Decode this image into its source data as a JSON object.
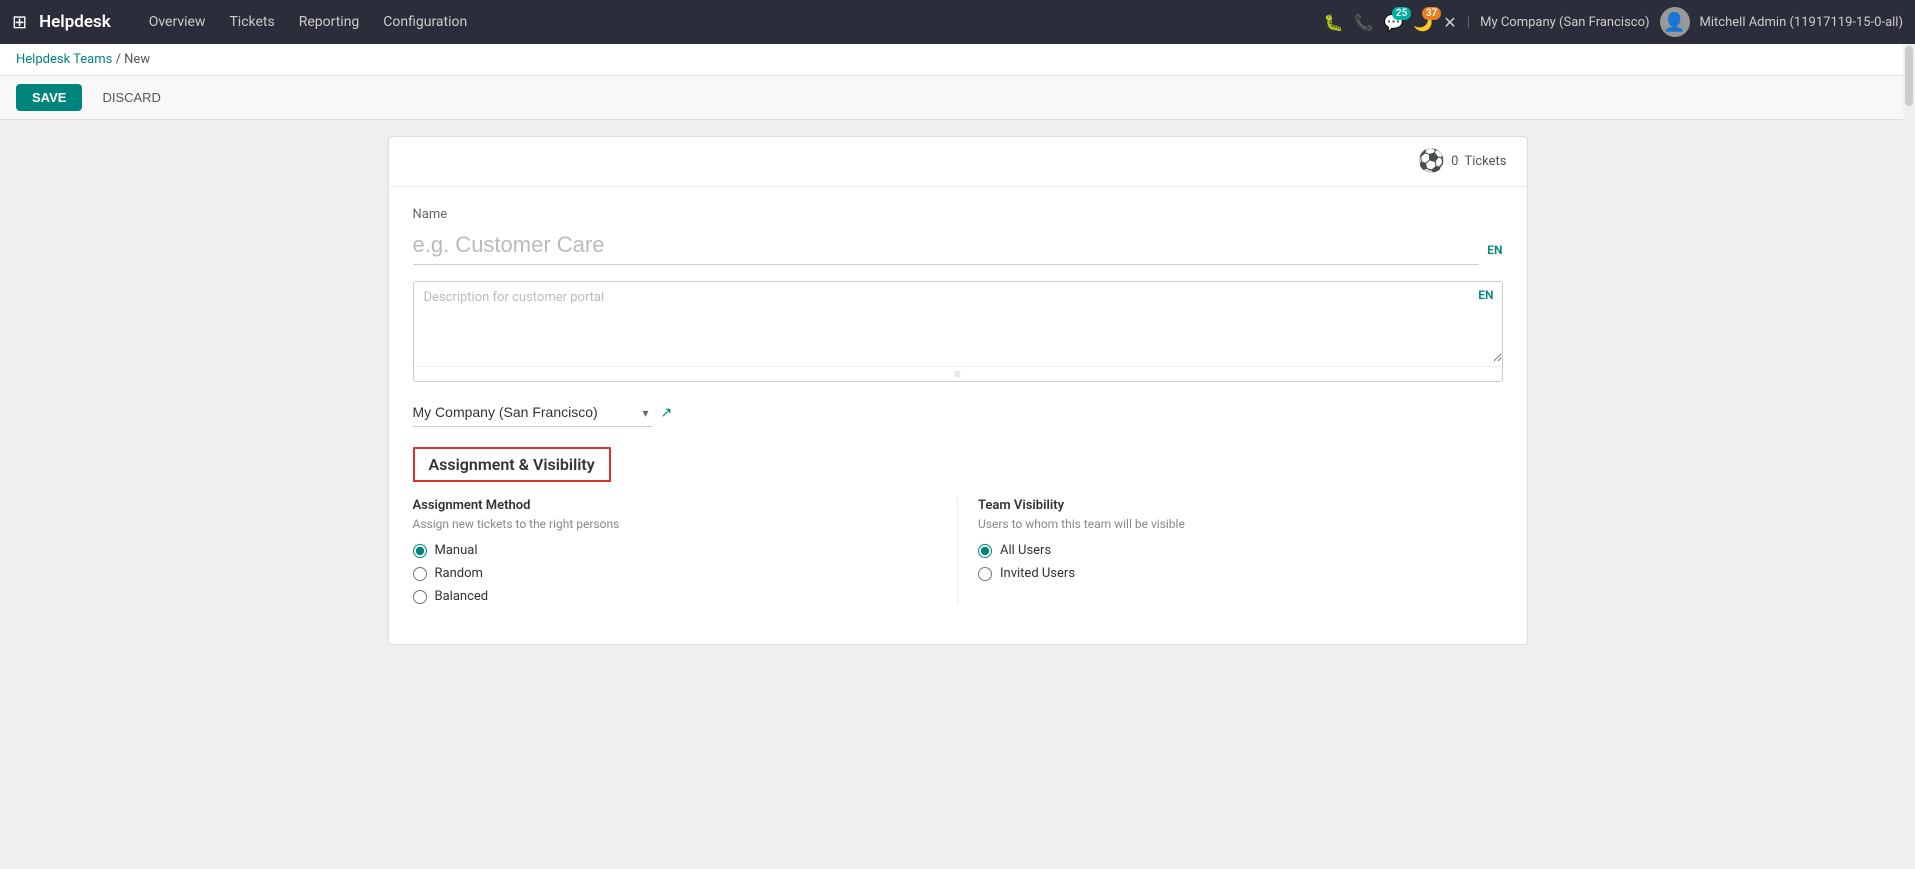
{
  "topnav": {
    "apps_icon": "⊞",
    "brand": "Helpdesk",
    "menu_items": [
      {
        "label": "Overview",
        "active": false
      },
      {
        "label": "Tickets",
        "active": false
      },
      {
        "label": "Reporting",
        "active": false
      },
      {
        "label": "Configuration",
        "active": false
      }
    ],
    "icons": {
      "bug": "🐛",
      "phone": "📞",
      "chat": "💬",
      "chat_badge": "25",
      "moon": "🌙",
      "moon_badge": "37",
      "close": "✕"
    },
    "company": "My Company (San Francisco)",
    "username": "Mitchell Admin (11917119-15-0-all)"
  },
  "breadcrumb": {
    "parent": "Helpdesk Teams",
    "current": "New"
  },
  "actions": {
    "save_label": "SAVE",
    "discard_label": "DISCARD"
  },
  "form": {
    "stat_icon": "⚽",
    "stat_count": "0",
    "stat_label": "Tickets",
    "name_label": "Name",
    "name_placeholder": "e.g. Customer Care",
    "lang_badge": "EN",
    "desc_placeholder": "Description for customer portal",
    "desc_lang_badge": "EN",
    "company_value": "My Company (San Francisco)",
    "section_title": "Assignment & Visibility",
    "assignment_method_label": "Assignment Method",
    "assignment_method_desc": "Assign new tickets to the right persons",
    "assignment_options": [
      {
        "value": "manual",
        "label": "Manual",
        "checked": true
      },
      {
        "value": "random",
        "label": "Random",
        "checked": false
      },
      {
        "value": "balanced",
        "label": "Balanced",
        "checked": false
      }
    ],
    "team_visibility_label": "Team Visibility",
    "team_visibility_desc": "Users to whom this team will be visible",
    "visibility_options": [
      {
        "value": "all_users",
        "label": "All Users",
        "checked": true
      },
      {
        "value": "invited_users",
        "label": "Invited Users",
        "checked": false
      }
    ]
  }
}
